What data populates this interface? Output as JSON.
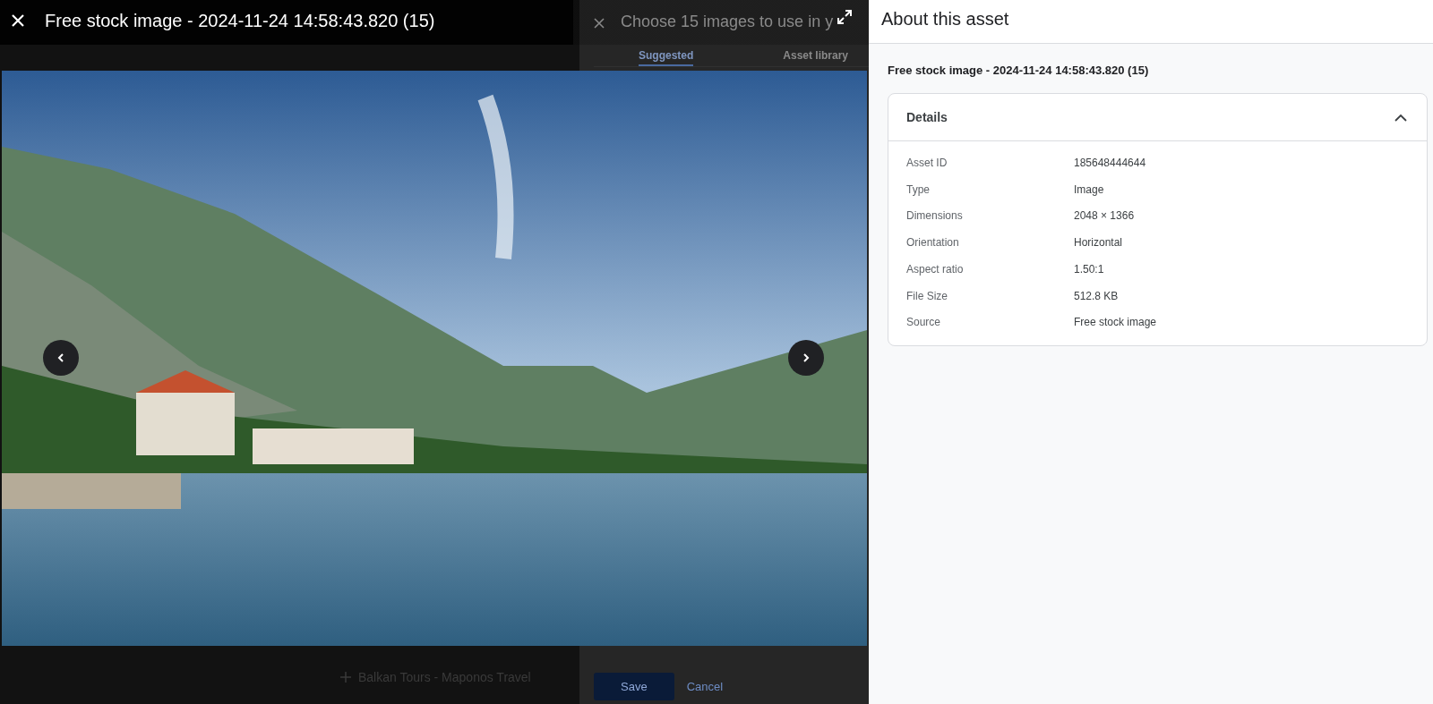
{
  "background_dialog": {
    "title": "Choose 15 images to use in y",
    "tabs": [
      {
        "label": "Suggested",
        "selected": true
      },
      {
        "label": "Asset library",
        "selected": false
      }
    ],
    "list_item": "Balkan Tours - Maponos Travel",
    "buttons": [
      {
        "label": "Save",
        "kind": "primary"
      },
      {
        "label": "Cancel",
        "kind": "text"
      }
    ]
  },
  "viewer": {
    "title": "Free stock image - 2024-11-24 14:58:43.820 (15)"
  },
  "asset_panel": {
    "title": "About this asset",
    "asset_name": "Free stock image - 2024-11-24 14:58:43.820 (15)",
    "details": {
      "title": "Details",
      "expanded": true,
      "rows": [
        {
          "label": "Asset ID",
          "value": "185648444644"
        },
        {
          "label": "Type",
          "value": "Image"
        },
        {
          "label": "Dimensions",
          "value": "2048 × 1366"
        },
        {
          "label": "Orientation",
          "value": "Horizontal"
        },
        {
          "label": "Aspect ratio",
          "value": "1.50:1"
        },
        {
          "label": "File Size",
          "value": "512.8 KB"
        },
        {
          "label": "Source",
          "value": "Free stock image"
        }
      ]
    }
  }
}
